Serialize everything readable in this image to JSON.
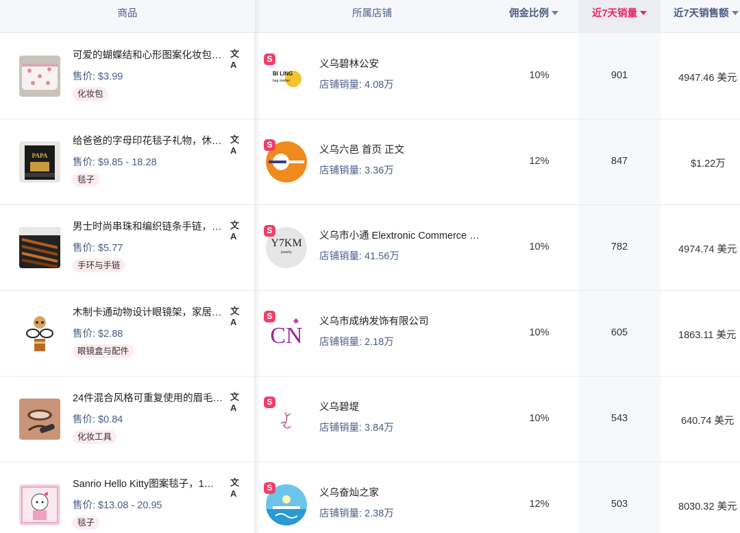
{
  "header": {
    "product": "商品",
    "shop": "所属店铺",
    "commission": "佣金比例",
    "sales7d": "近7天销量",
    "revenue7d": "近7天销售额"
  },
  "colors": {
    "accent": "#e8265e",
    "label_blue": "#4a5c86",
    "tag_bg": "#fdecef",
    "badge": "#ef3f6a"
  },
  "rows": [
    {
      "name": "可爱的蝴蝶结和心形图案化妆包…",
      "price": "售价: $3.99",
      "tag": "化妆包",
      "shop": "义乌碧林公安",
      "shop_sales": "店铺销量: 4.08万",
      "commission": "10%",
      "sales": "901",
      "revenue": "4947.46 美元",
      "logo_text": "BI LING",
      "logo_sub": "bag marker"
    },
    {
      "name": "给爸爸的字母印花毯子礼物，休…",
      "price": "售价: $9.85 - 18.28",
      "tag": "毯子",
      "shop": "义乌六邑 首页 正文",
      "shop_sales": "店铺销量: 3.36万",
      "commission": "12%",
      "sales": "847",
      "revenue": "$1.22万",
      "thumb_text": "PAPA"
    },
    {
      "name": "男士时尚串珠和编织链条手链，…",
      "price": "售价: $5.77",
      "tag": "手环与手链",
      "shop": "义乌市小通 Elextronic Commerce …",
      "shop_sales": "店铺销量: 41.56万",
      "commission": "10%",
      "sales": "782",
      "revenue": "4974.74 美元",
      "logo_text": "Y7KM",
      "logo_sub": "jewelry"
    },
    {
      "name": "木制卡通动物设计眼镜架，家居…",
      "price": "售价: $2.88",
      "tag": "眼镜盒与配件",
      "shop": "义乌市成纳发饰有限公司",
      "shop_sales": "店铺销量: 2.18万",
      "commission": "10%",
      "sales": "605",
      "revenue": "1863.11 美元",
      "logo_text": "CN"
    },
    {
      "name": "24件混合风格可重复使用的眉毛…",
      "price": "售价: $0.84",
      "tag": "化妆工具",
      "shop": "义乌碧堤",
      "shop_sales": "店铺销量: 3.84万",
      "commission": "10%",
      "sales": "543",
      "revenue": "640.74 美元"
    },
    {
      "name": "Sanrio Hello Kitty图案毯子，1…",
      "price": "售价: $13.08 - 20.95",
      "tag": "毯子",
      "shop": "义乌奋灿之家",
      "shop_sales": "店铺销量: 2.38万",
      "commission": "12%",
      "sales": "503",
      "revenue": "8030.32 美元"
    }
  ]
}
